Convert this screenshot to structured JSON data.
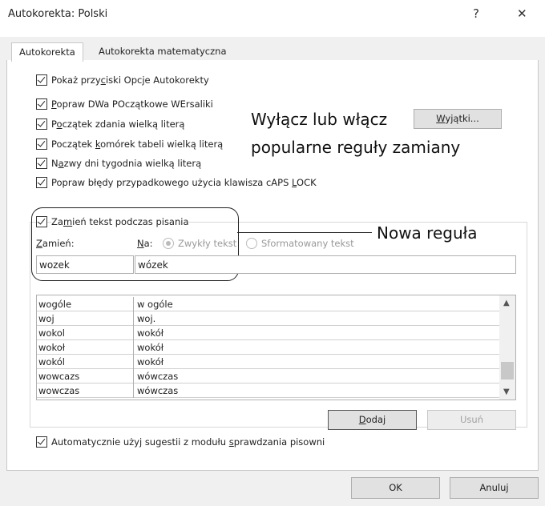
{
  "window": {
    "title": "Autokorekta: Polski",
    "help": "?",
    "close": "✕"
  },
  "tabs": [
    {
      "label": "Autokorekta"
    },
    {
      "label": "Autokorekta matematyczna"
    }
  ],
  "options": {
    "show_buttons": {
      "pre": "Pokaż przy",
      "u": "c",
      "post": "iski Opcje Autokorekty"
    },
    "two_initial": {
      "pre": "",
      "u": "P",
      "post": "opraw DWa POczątkowe WErsaliki"
    },
    "sentence": {
      "pre": "P",
      "u": "o",
      "post": "czątek zdania wielką literą"
    },
    "table_cells": {
      "pre": "Początek ",
      "u": "k",
      "post": "omórek tabeli wielką literą"
    },
    "day_names": {
      "pre": "N",
      "u": "a",
      "post": "zwy dni tygodnia wielką literą"
    },
    "caps_lock": {
      "pre": "Popraw błędy przypadkowego użycia klawisza cAPS ",
      "u": "L",
      "post": "OCK"
    },
    "replace_text": {
      "pre": "Za",
      "u": "m",
      "post": "ień tekst podczas pisania"
    },
    "auto_suggest": {
      "pre": "Automatycznie użyj sugestii z modułu ",
      "u": "s",
      "post": "prawdzania pisowni"
    }
  },
  "exceptions_button": {
    "pre": "",
    "u": "W",
    "post": "yjątki..."
  },
  "annotation1": {
    "line1": "Wyłącz lub włącz",
    "line2": "popularne reguły zamiany"
  },
  "annotation2": "Nowa reguła",
  "replace": {
    "replace_label": {
      "pre": "",
      "u": "Z",
      "post": "amień:"
    },
    "with_label": {
      "pre": "",
      "u": "N",
      "post": "a:"
    },
    "plain_text": "Zwykły tekst",
    "formatted_text": "Sformatowany tekst",
    "replace_value": "wozek",
    "with_value": "wózek"
  },
  "entries": [
    {
      "from": "wogóle",
      "to": "w ogóle"
    },
    {
      "from": "woj",
      "to": "woj."
    },
    {
      "from": "wokol",
      "to": "wokół"
    },
    {
      "from": "wokoł",
      "to": "wokół"
    },
    {
      "from": "wokól",
      "to": "wokół"
    },
    {
      "from": "wowcazs",
      "to": "wówczas"
    },
    {
      "from": "wowczas",
      "to": "wówczas"
    }
  ],
  "add_button": {
    "pre": "",
    "u": "D",
    "post": "odaj"
  },
  "delete_button": "Usuń",
  "ok_button": "OK",
  "cancel_button": "Anuluj",
  "colors": {
    "dialog_bg": "#f0f0f0",
    "panel_bg": "#ffffff",
    "border": "#c8c8c8"
  },
  "icons": [
    "help-icon",
    "close-icon",
    "scroll-up-icon",
    "scroll-down-icon"
  ]
}
